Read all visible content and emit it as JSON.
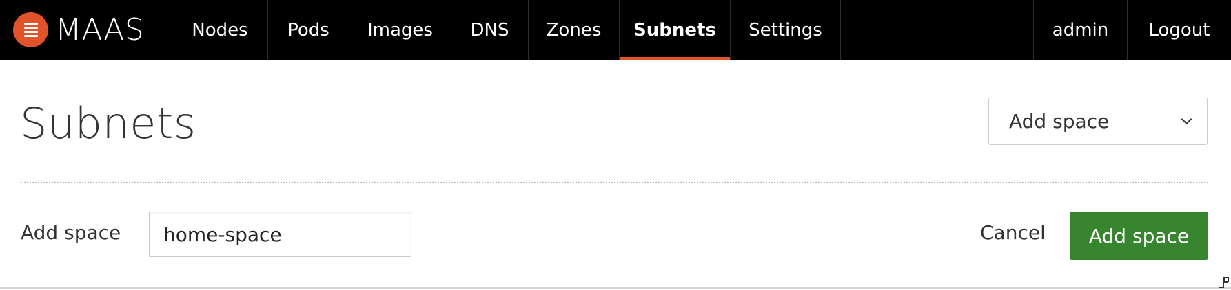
{
  "brand": {
    "name": "MAAS",
    "accent_color": "#e0532b"
  },
  "nav": {
    "items": [
      {
        "label": "Nodes"
      },
      {
        "label": "Pods"
      },
      {
        "label": "Images"
      },
      {
        "label": "DNS"
      },
      {
        "label": "Zones"
      },
      {
        "label": "Subnets",
        "active": true
      },
      {
        "label": "Settings"
      }
    ],
    "user": "admin",
    "logout": "Logout"
  },
  "header": {
    "title": "Subnets",
    "action_select": {
      "selected": "Add space"
    }
  },
  "form": {
    "label": "Add space",
    "input_value": "home-space",
    "cancel_label": "Cancel",
    "submit_label": "Add space",
    "submit_color": "#38852f"
  },
  "icons": {
    "logo": "maas-logo-icon",
    "dropdown": "chevron-down-icon",
    "corner": "resize-handle-icon"
  }
}
